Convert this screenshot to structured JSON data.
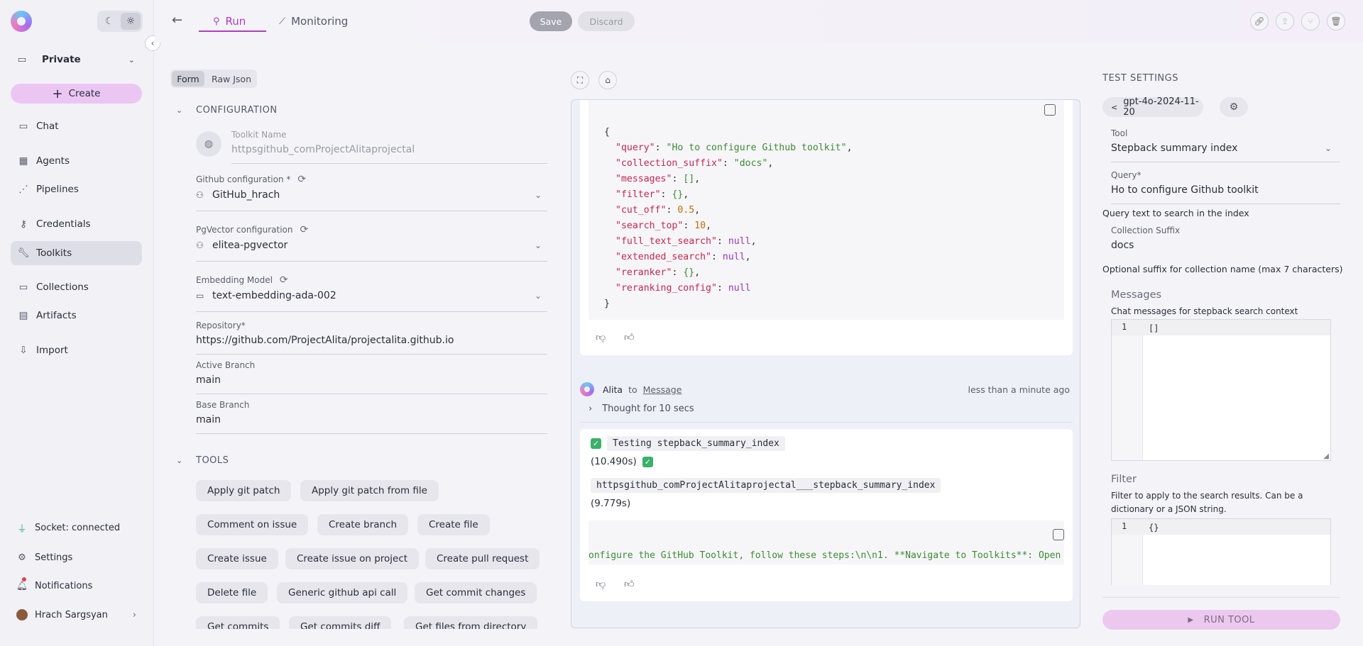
{
  "sidebar": {
    "workspace": "Private",
    "create_label": "Create",
    "nav": [
      "Chat",
      "Agents",
      "Pipelines",
      "Credentials",
      "Toolkits",
      "Collections",
      "Artifacts",
      "Import"
    ],
    "active": "Toolkits",
    "socket_status": "Socket: connected",
    "settings_label": "Settings",
    "notifications_label": "Notifications",
    "user_name": "Hrach Sargsyan"
  },
  "header": {
    "tabs": [
      "Run",
      "Monitoring"
    ],
    "active_tab": "Run",
    "save_label": "Save",
    "discard_label": "Discard"
  },
  "form": {
    "mode_tabs": [
      "Form",
      "Raw Json"
    ],
    "active_mode": "Form",
    "config_title": "CONFIGURATION",
    "toolkit_name_label": "Toolkit Name",
    "toolkit_name_value": "httpsgithub_comProjectAlitaprojectal",
    "github_config_label": "Github configuration *",
    "github_config_value": "GitHub_hrach",
    "pgvector_label": "PgVector configuration",
    "pgvector_value": "elitea-pgvector",
    "embedding_label": "Embedding Model",
    "embedding_value": "text-embedding-ada-002",
    "repository_label": "Repository*",
    "repository_value": "https://github.com/ProjectAlita/projectalita.github.io",
    "active_branch_label": "Active Branch",
    "active_branch_value": "main",
    "base_branch_label": "Base Branch",
    "base_branch_value": "main",
    "tools_title": "TOOLS",
    "tools": [
      [
        "Apply git patch",
        "Apply git patch from file"
      ],
      [
        "Comment on issue",
        "Create branch",
        "Create file"
      ],
      [
        "Create issue",
        "Create issue on project",
        "Create pull request"
      ],
      [
        "Delete file",
        "Generic github api call",
        "Get commit changes"
      ],
      [
        "Get commits",
        "Get commits diff",
        "Get files from directory"
      ]
    ]
  },
  "chat": {
    "json_lines": [
      {
        "key": "query",
        "value": "\"Ho to configure Github toolkit\"",
        "type": "s"
      },
      {
        "key": "collection_suffix",
        "value": "\"docs\"",
        "type": "s"
      },
      {
        "key": "messages",
        "value": "[]",
        "type": "s"
      },
      {
        "key": "filter",
        "value": "{}",
        "type": "s"
      },
      {
        "key": "cut_off",
        "value": "0.5",
        "type": "n"
      },
      {
        "key": "search_top",
        "value": "10",
        "type": "n"
      },
      {
        "key": "full_text_search",
        "value": "null",
        "type": "nl"
      },
      {
        "key": "extended_search",
        "value": "null",
        "type": "nl"
      },
      {
        "key": "reranker",
        "value": "{}",
        "type": "s"
      },
      {
        "key": "reranking_config",
        "value": "null",
        "type": "nl"
      }
    ],
    "sender": "Alita",
    "to_label": "to",
    "recipient": "Message",
    "timestamp": "less than a minute ago",
    "thought": "Thought for 10 secs",
    "testing_label": "Testing stepback_summary_index",
    "duration_1": "(10.490s)",
    "call_label": "httpsgithub_comProjectAlitaprojectal___stepback_summary_index",
    "duration_2": "(9.779s)",
    "output_text": "onfigure the GitHub Toolkit, follow these steps:\\n\\n1. **Navigate to Toolkits**: Open"
  },
  "test_settings": {
    "title": "TEST SETTINGS",
    "model": "gpt-4o-2024-11-20",
    "tool_label": "Tool",
    "tool_value": "Stepback summary index",
    "query_label": "Query*",
    "query_value": "Ho to configure Github toolkit",
    "query_help": "Query text to search in the index",
    "suffix_label": "Collection Suffix",
    "suffix_value": "docs",
    "suffix_help": "Optional suffix for collection name (max 7 characters)",
    "messages_label": "Messages",
    "messages_help": "Chat messages for stepback search context",
    "messages_line_no": "1",
    "messages_value": "[]",
    "filter_label": "Filter",
    "filter_help": "Filter to apply to the search results. Can be a dictionary or a JSON string.",
    "filter_line_no": "1",
    "filter_value": "{}",
    "run_label": "RUN TOOL"
  }
}
